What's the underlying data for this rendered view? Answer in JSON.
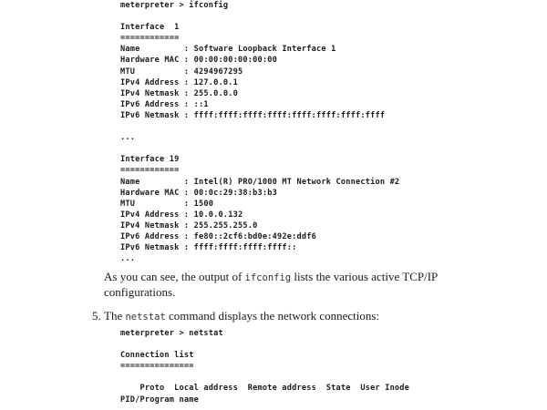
{
  "code_block_1": {
    "lines": [
      "meterpreter > ifconfig",
      "",
      "Interface  1",
      "============",
      "Name         : Software Loopback Interface 1",
      "Hardware MAC : 00:00:00:00:00:00",
      "MTU          : 4294967295",
      "IPv4 Address : 127.0.0.1",
      "IPv4 Netmask : 255.0.0.0",
      "IPv6 Address : ::1",
      "IPv6 Netmask : ffff:ffff:ffff:ffff:ffff:ffff:ffff:ffff",
      "",
      "...",
      "",
      "Interface 19",
      "============",
      "Name         : Intel(R) PRO/1000 MT Network Connection #2",
      "Hardware MAC : 00:0c:29:38:b3:b3",
      "MTU          : 1500",
      "IPv4 Address : 10.0.0.132",
      "IPv4 Netmask : 255.255.255.0",
      "IPv6 Address : fe80::2cf6:bd0e:492e:ddf6",
      "IPv6 Netmask : ffff:ffff:ffff:ffff::",
      "..."
    ]
  },
  "paragraph_1": {
    "before": "As you can see, the output of ",
    "code": "ifconfig",
    "after": " lists the various active TCP/IP configurations."
  },
  "step_5": {
    "number": "5.",
    "before": "The ",
    "code": "netstat",
    "after": " command displays the network connections:"
  },
  "code_block_2": {
    "lines": [
      "meterpreter > netstat",
      "",
      "Connection list",
      "===============",
      "",
      "    Proto  Local address  Remote address  State  User Inode",
      "PID/Program name"
    ]
  }
}
